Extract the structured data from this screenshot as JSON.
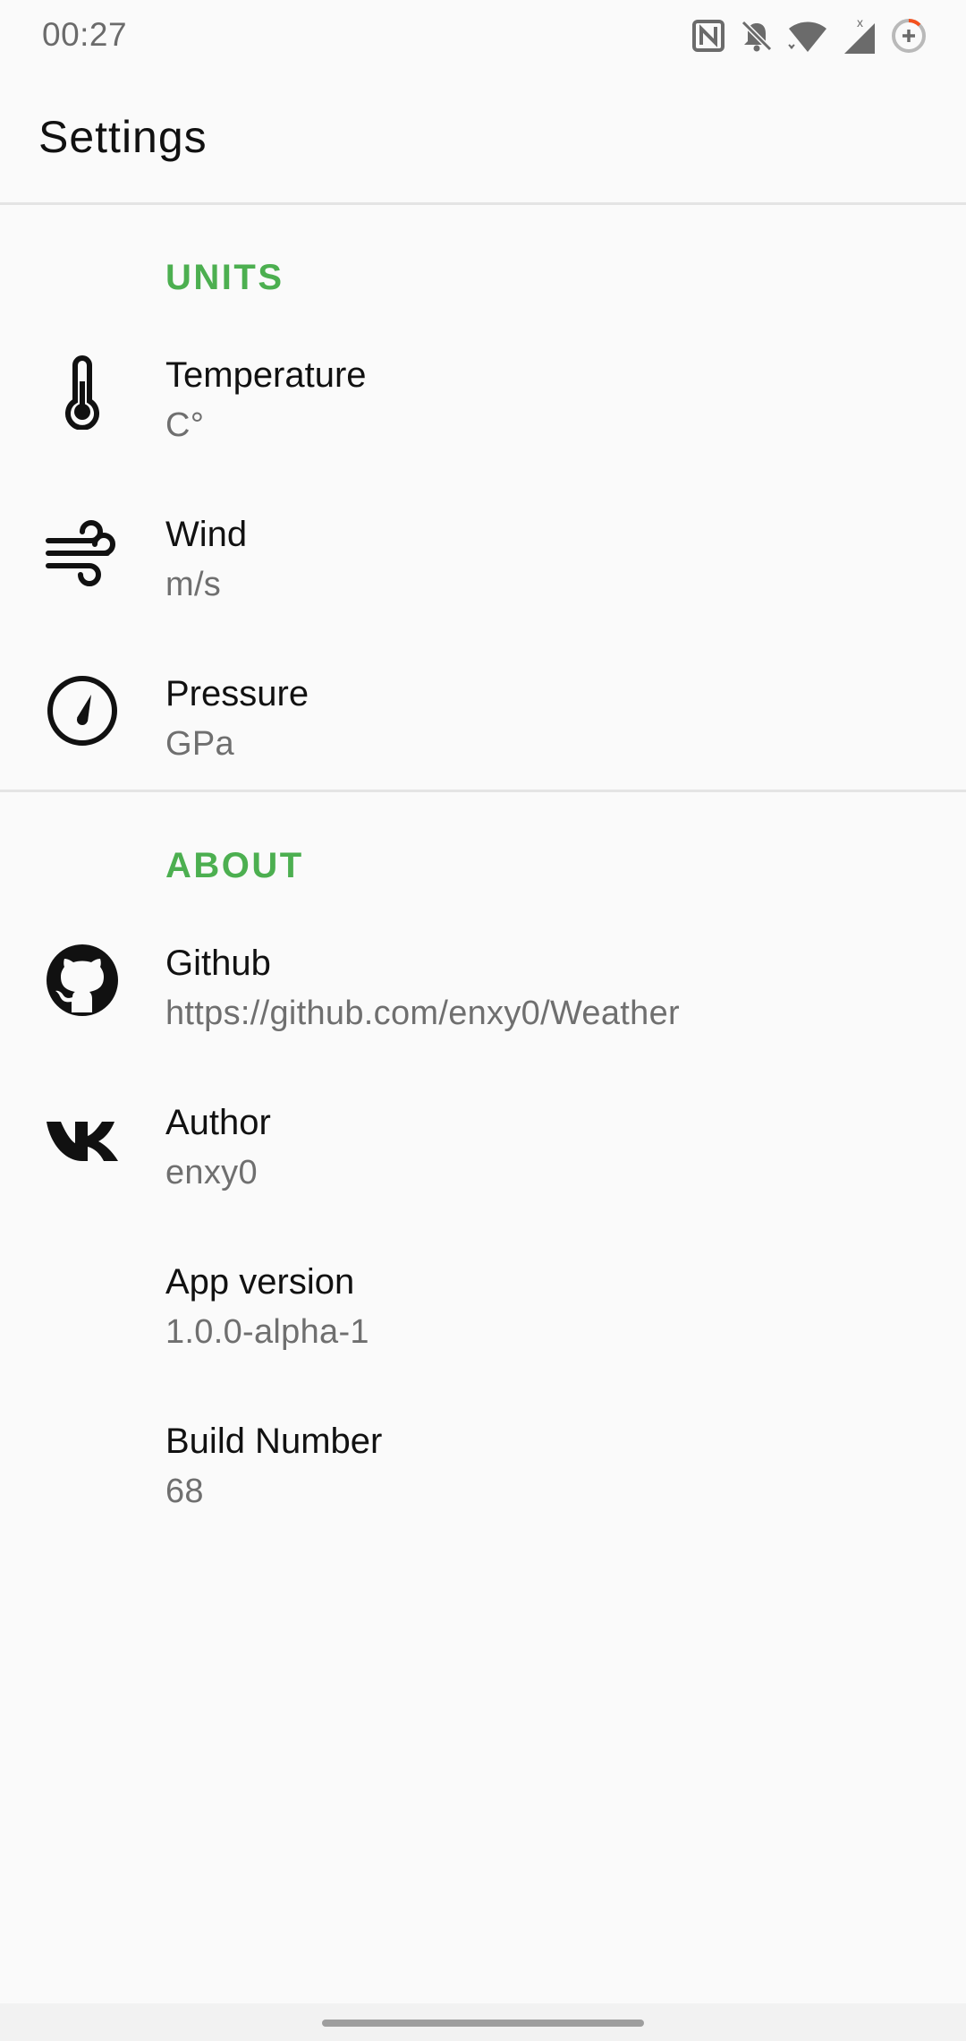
{
  "status_bar": {
    "time": "00:27",
    "icons": [
      "nfc-icon",
      "notifications-off-icon",
      "wifi-icon",
      "signal-icon",
      "battery-saver-icon"
    ]
  },
  "app_bar": {
    "title": "Settings"
  },
  "sections": {
    "units": {
      "header": "UNITS",
      "items": [
        {
          "icon": "thermometer-icon",
          "title": "Temperature",
          "summary": "C°"
        },
        {
          "icon": "wind-icon",
          "title": "Wind",
          "summary": "m/s"
        },
        {
          "icon": "gauge-icon",
          "title": "Pressure",
          "summary": "GPa"
        }
      ]
    },
    "about": {
      "header": "ABOUT",
      "items": [
        {
          "icon": "github-icon",
          "title": "Github",
          "summary": "https://github.com/enxy0/Weather"
        },
        {
          "icon": "vk-icon",
          "title": "Author",
          "summary": "enxy0"
        },
        {
          "icon": "",
          "title": "App version",
          "summary": "1.0.0-alpha-1"
        },
        {
          "icon": "",
          "title": "Build Number",
          "summary": "68"
        }
      ]
    }
  },
  "colors": {
    "accent": "#4caf50",
    "background": "#fafafa",
    "divider": "#e4e4e4",
    "summary_text": "#6f6f6f"
  }
}
